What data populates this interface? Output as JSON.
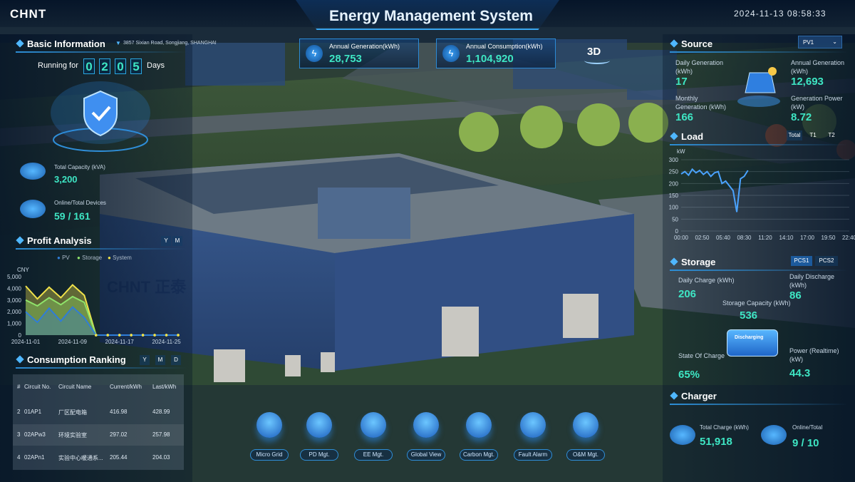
{
  "header": {
    "brand": "CHNT",
    "title": "Energy Management System",
    "datetime": "2024-11-13  08:58:33"
  },
  "basic": {
    "title": "Basic Information",
    "address": "3857 Sixian Road, Songjiang, SHANGHAI",
    "running_prefix": "Running for",
    "days": [
      "0",
      "2",
      "0",
      "5"
    ],
    "running_suffix": "Days",
    "capacity_label": "Total Capacity (kVA)",
    "capacity_value": "3,200",
    "devices_label": "Online/Total Devices",
    "devices_value": "59 / 161"
  },
  "kpi": {
    "gen_label": "Annual Generation(kWh)",
    "gen_value": "28,753",
    "cons_label": "Annual Consumption(kWh)",
    "cons_value": "1,104,920",
    "view3d": "3D"
  },
  "profit": {
    "title": "Profit Analysis",
    "toggles": [
      "Y",
      "M"
    ],
    "legend": [
      "PV",
      "Storage",
      "System"
    ],
    "unit": "CNY"
  },
  "ranking": {
    "title": "Consumption Ranking",
    "toggles": [
      "Y",
      "M",
      "D"
    ],
    "headers": [
      "#",
      "Circuit No.",
      "Circuit Name",
      "Current/kWh",
      "Last/kWh"
    ],
    "rows": [
      [
        "2",
        "01AP1",
        "厂区配电箱",
        "416.98",
        "428.99"
      ],
      [
        "3",
        "02APw3",
        "环境实验室",
        "297.02",
        "257.98"
      ],
      [
        "4",
        "02APn1",
        "实验中心暖通系...",
        "205.44",
        "204.03"
      ]
    ]
  },
  "source": {
    "title": "Source",
    "select": "PV1",
    "daily_label": "Daily Generation (kWh)",
    "daily_value": "17",
    "annual_label": "Annual Generation (kWh)",
    "annual_value": "12,693",
    "monthly_label": "Monthly Generation (kWh)",
    "monthly_value": "166",
    "power_label": "Generation Power (kW)",
    "power_value": "8.72"
  },
  "load": {
    "title": "Load",
    "tabs": [
      "Total",
      "T1",
      "T2"
    ],
    "unit": "kW"
  },
  "storage": {
    "title": "Storage",
    "tabs": [
      "PCS1",
      "PCS2"
    ],
    "charge_label": "Daily Charge (kWh)",
    "charge_value": "206",
    "discharge_label": "Daily Discharge (kWh)",
    "discharge_value": "86",
    "capacity_label": "Storage Capacity (kWh)",
    "capacity_value": "536",
    "status": "Discharging",
    "soc_label": "State Of Charge",
    "soc_value": "65%",
    "power_label": "Power (Realtime) (kW)",
    "power_value": "44.3"
  },
  "charger": {
    "title": "Charger",
    "total_label": "Total Charge (kWh)",
    "total_value": "51,918",
    "online_label": "Online/Total",
    "online_value": "9 / 10"
  },
  "nav": [
    "Micro Grid",
    "PD Mgt.",
    "EE Mgt.",
    "Global View",
    "Carbon Mgt.",
    "Fault Alarm",
    "O&M Mgt."
  ],
  "colors": {
    "accent": "#3ee6c4",
    "frame": "#2d8ed6",
    "pv": "#2f7dd8",
    "storage": "#8fe36a",
    "system": "#f0e24a"
  },
  "chart_data": [
    {
      "type": "area",
      "title": "Profit Analysis",
      "ylabel": "CNY",
      "x": [
        "2024-11-01",
        "2024-11-03",
        "2024-11-05",
        "2024-11-07",
        "2024-11-09",
        "2024-11-11",
        "2024-11-13",
        "2024-11-15",
        "2024-11-17",
        "2024-11-19",
        "2024-11-21",
        "2024-11-23",
        "2024-11-25",
        "2024-11-27"
      ],
      "ylim": [
        0,
        5000
      ],
      "yticks": [
        0,
        1000,
        2000,
        3000,
        4000,
        5000
      ],
      "xticks": [
        "2024-11-01",
        "2024-11-09",
        "2024-11-17",
        "2024-11-25"
      ],
      "series": [
        {
          "name": "PV",
          "values": [
            2000,
            1100,
            2300,
            1200,
            2400,
            1500,
            0,
            0,
            0,
            0,
            0,
            0,
            0,
            0
          ]
        },
        {
          "name": "Storage",
          "values": [
            3000,
            2500,
            3200,
            2600,
            3300,
            2800,
            0,
            0,
            0,
            0,
            0,
            0,
            0,
            0
          ]
        },
        {
          "name": "System",
          "values": [
            4200,
            3100,
            4100,
            3200,
            4300,
            3400,
            0,
            0,
            0,
            0,
            0,
            0,
            0,
            0
          ]
        }
      ]
    },
    {
      "type": "line",
      "title": "Load",
      "ylabel": "kW",
      "ylim": [
        0,
        300
      ],
      "yticks": [
        0,
        50,
        100,
        150,
        200,
        250,
        300
      ],
      "xticks": [
        "00:00",
        "02:50",
        "05:40",
        "08:30",
        "11:20",
        "14:10",
        "17:00",
        "19:50",
        "22:40"
      ],
      "series": [
        {
          "name": "Total",
          "x": [
            "00:00",
            "00:30",
            "01:00",
            "01:30",
            "02:00",
            "02:30",
            "03:00",
            "03:30",
            "04:00",
            "04:30",
            "05:00",
            "05:30",
            "06:00",
            "06:30",
            "07:00",
            "07:30",
            "08:00",
            "08:30",
            "09:00"
          ],
          "values": [
            240,
            250,
            235,
            260,
            245,
            255,
            238,
            250,
            230,
            245,
            250,
            200,
            210,
            190,
            170,
            80,
            220,
            230,
            255
          ]
        }
      ]
    }
  ]
}
